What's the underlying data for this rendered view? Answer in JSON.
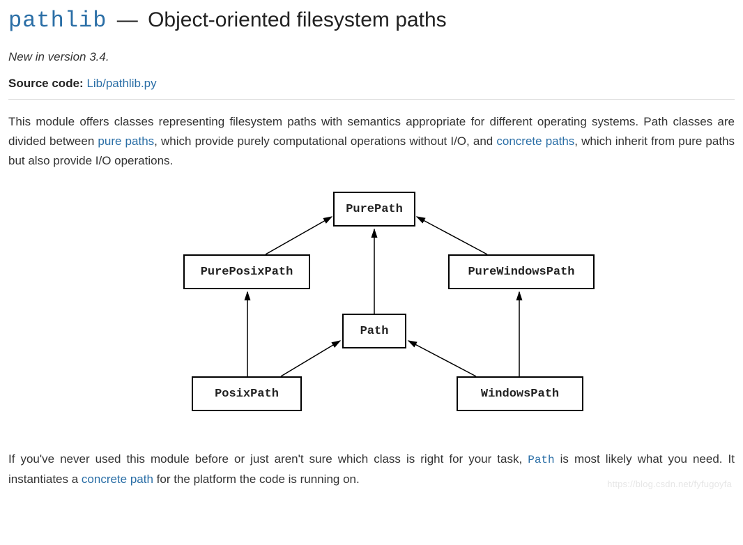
{
  "title": {
    "code": "pathlib",
    "rest": " Object-oriented filesystem paths"
  },
  "version_note": "New in version 3.4.",
  "source": {
    "label": "Source code:",
    "link": "Lib/pathlib.py"
  },
  "para1": {
    "t1": "This module offers classes representing filesystem paths with semantics appropriate for different operating systems. Path classes are divided between ",
    "link1": "pure paths",
    "t2": ", which provide purely computational operations without I/O, and ",
    "link2": "concrete paths",
    "t3": ", which inherit from pure paths but also provide I/O operations."
  },
  "diagram": {
    "purepath": "PurePath",
    "pureposix": "PurePosixPath",
    "purewindows": "PureWindowsPath",
    "path": "Path",
    "posix": "PosixPath",
    "windows": "WindowsPath"
  },
  "para2": {
    "t1": "If you've never used this module before or just aren't sure which class is right for your task, ",
    "code": "Path",
    "t2": " is most likely what you need. It instantiates a ",
    "link": "concrete path",
    "t3": " for the platform the code is running on."
  },
  "watermark": "https://blog.csdn.net/fyfugoyfa"
}
